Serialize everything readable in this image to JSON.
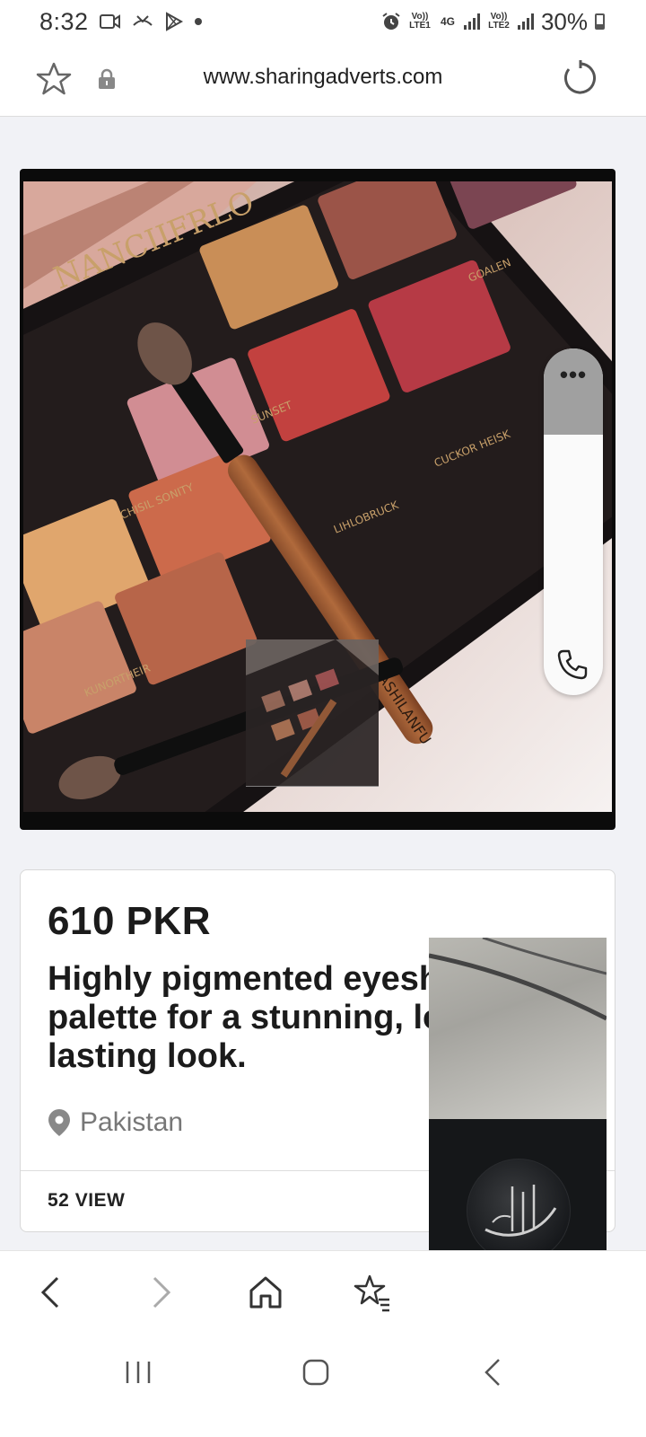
{
  "status_bar": {
    "time": "8:32",
    "network_sim1": "Vo)) LTE1",
    "network_type": "4G",
    "network_sim2": "Vo)) LTE2",
    "battery": "30%"
  },
  "browser": {
    "url": "www.sharingadverts.com"
  },
  "side_panel": {
    "more_label": "•••"
  },
  "listing": {
    "price": "610 PKR",
    "title": "Highly pigmented eyeshadow palette for a stunning, long-lasting look.",
    "title_visible": "Highly pigmented eyes\nfor a stunning, long-las\nlook.",
    "location": "Pakistan",
    "views": "52 VIEW"
  },
  "image_text": {
    "brand": "NANCIIFRLO",
    "brush_brand": "NASHILANFU",
    "shade_sunset": "SUNSET",
    "shade_goalen": "GOALEN",
    "shade_cuckor": "CUCKOR HEISK",
    "shade_chisil": "CHISIL SONITY",
    "shade_lihlo": "LIHLOBRUCK",
    "shade_kunor": "KUNORTHEIR"
  },
  "colors": {
    "accent": "#1b1b1b",
    "muted": "#777777",
    "background": "#f1f2f6"
  },
  "icons": {
    "star": "star-icon",
    "lock": "lock-icon",
    "reload": "reload-icon",
    "location": "location-pin-icon",
    "phone": "phone-icon",
    "back": "back-arrow-icon",
    "forward": "forward-arrow-icon",
    "home": "home-icon",
    "bookmarks": "bookmarks-icon",
    "cast": "cast-icon"
  }
}
